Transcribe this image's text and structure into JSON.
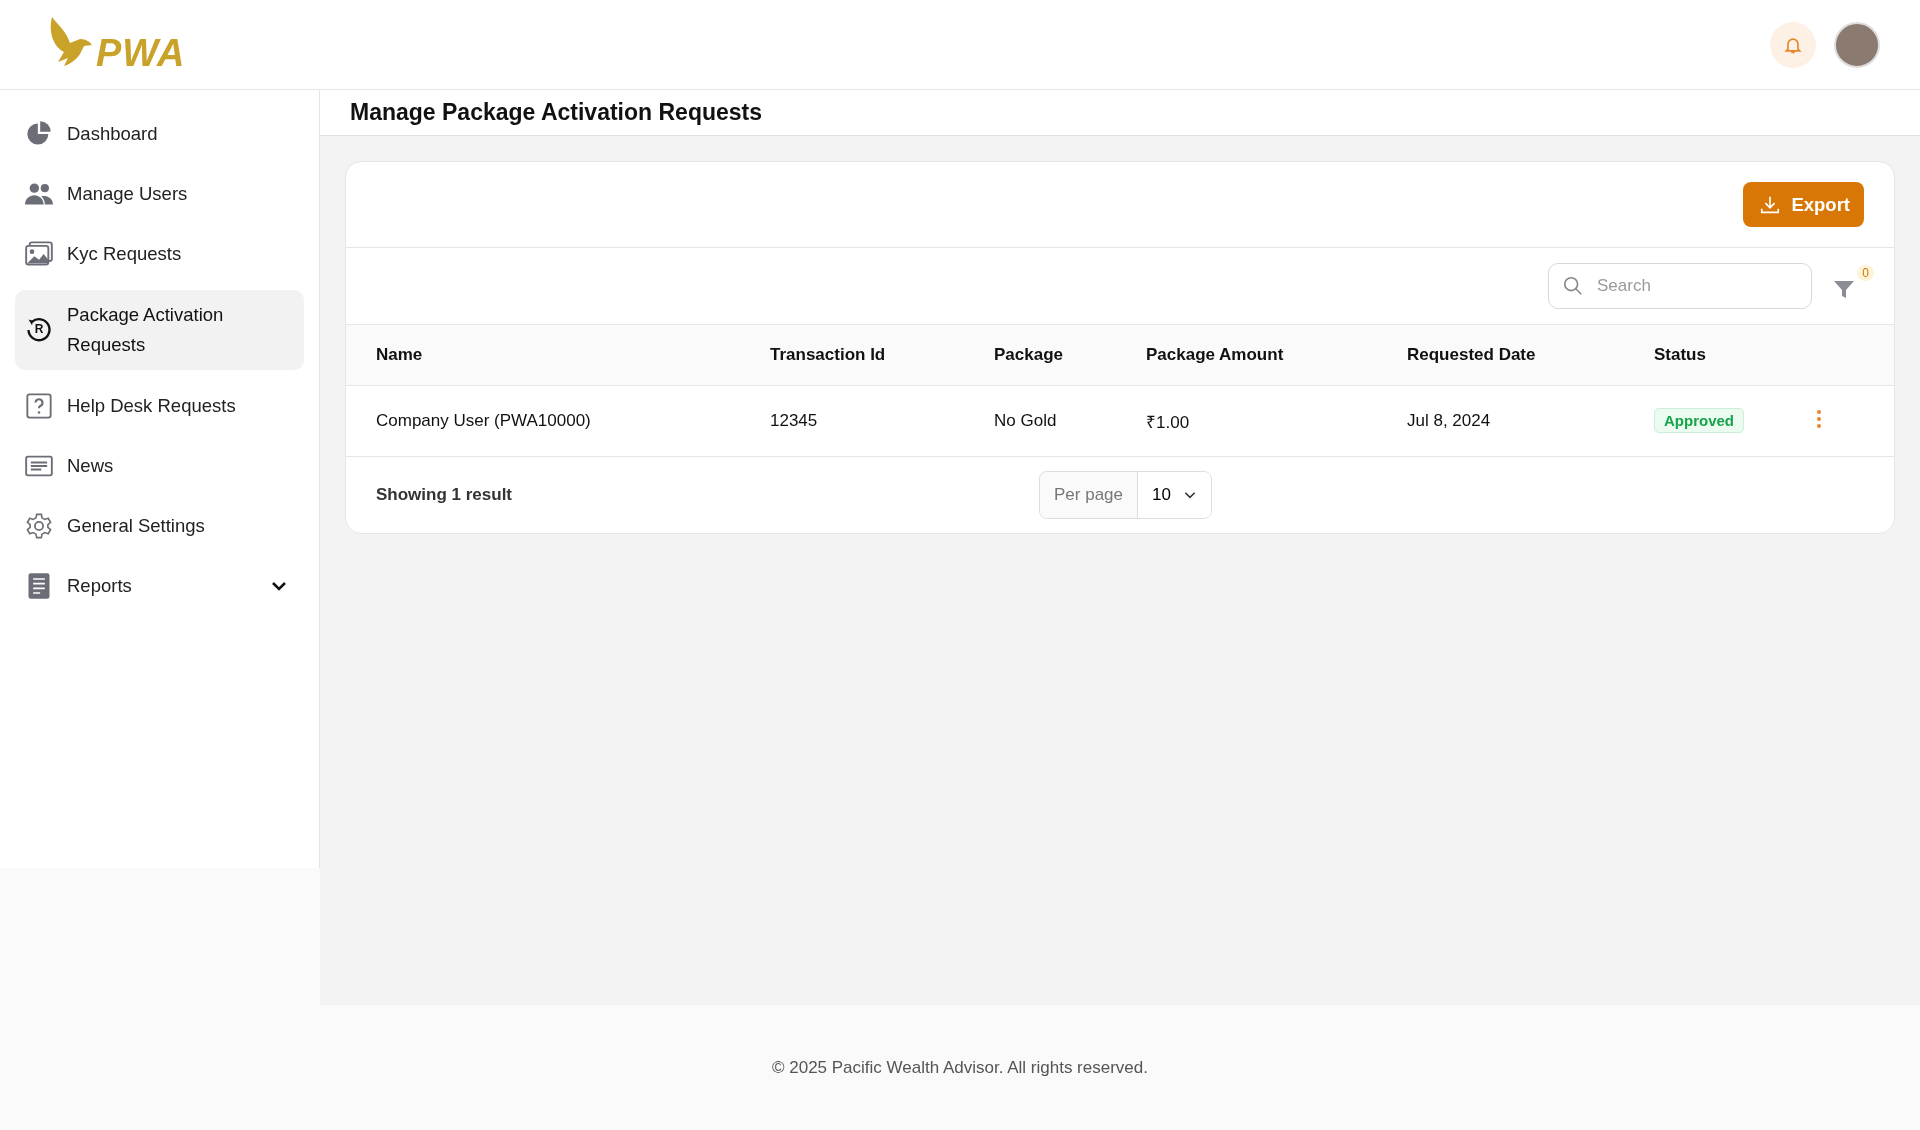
{
  "header": {
    "logo_text": "PWA"
  },
  "sidebar": {
    "items": [
      {
        "label": "Dashboard",
        "selected": false
      },
      {
        "label": "Manage Users",
        "selected": false
      },
      {
        "label": "Kyc Requests",
        "selected": false
      },
      {
        "label": "Package Activation Requests",
        "selected": true,
        "icon_text": "R"
      },
      {
        "label": "Help Desk Requests",
        "selected": false
      },
      {
        "label": "News",
        "selected": false
      },
      {
        "label": "General Settings",
        "selected": false
      },
      {
        "label": "Reports",
        "selected": false,
        "expanded": false
      }
    ]
  },
  "page": {
    "title": "Manage Package Activation Requests"
  },
  "toolbar": {
    "export_label": "Export",
    "search": {
      "placeholder": "Search"
    },
    "filter_count": "0"
  },
  "table": {
    "columns": [
      "Name",
      "Transaction Id",
      "Package",
      "Package Amount",
      "Requested Date",
      "Status"
    ],
    "rows": [
      {
        "cells": [
          "Company User (PWA10000)",
          "12345",
          "No Gold",
          "₹1.00",
          "Jul 8, 2024"
        ],
        "status": "Approved"
      }
    ]
  },
  "pagination": {
    "summary": "Showing 1 result",
    "per_page_label": "Per page",
    "per_page_value": "10"
  },
  "footer": {
    "text": "© 2025 Pacific Wealth Advisor. All rights reserved."
  }
}
